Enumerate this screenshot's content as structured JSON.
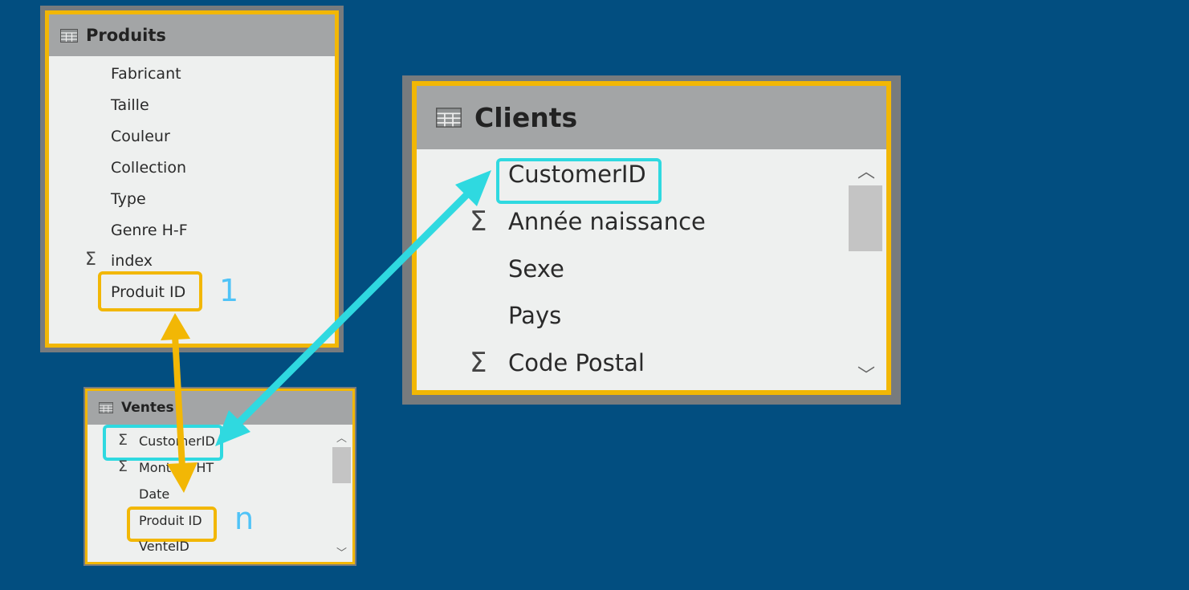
{
  "colors": {
    "background": "#024e80",
    "frame_gray": "#777b7e",
    "header_gray": "#a3a5a6",
    "panel_bg": "#eef0ef",
    "orange": "#f2b705",
    "cyan": "#2fd9e0"
  },
  "produits": {
    "title": "Produits",
    "fields": [
      "Fabricant",
      "Taille",
      "Couleur",
      "Collection",
      "Type",
      "Genre H-F",
      "index",
      "Produit ID"
    ],
    "sigma": "Σ",
    "cardinality": "1"
  },
  "clients": {
    "title": "Clients",
    "fields": [
      "CustomerID",
      "Année naissance",
      "Sexe",
      "Pays",
      "Code Postal"
    ],
    "sigma": "Σ"
  },
  "ventes": {
    "title": "Ventes",
    "fields": [
      "CustomerID",
      "Montant HT",
      "Date",
      "Produit ID",
      "VenteID"
    ],
    "sigma": "Σ",
    "cardinality": "n"
  },
  "icons": {
    "table": "table-grid-icon",
    "scroll_up": "chevron-up-icon",
    "scroll_down": "chevron-down-icon",
    "arrows": [
      "double-arrow-orange",
      "double-arrow-cyan"
    ]
  }
}
